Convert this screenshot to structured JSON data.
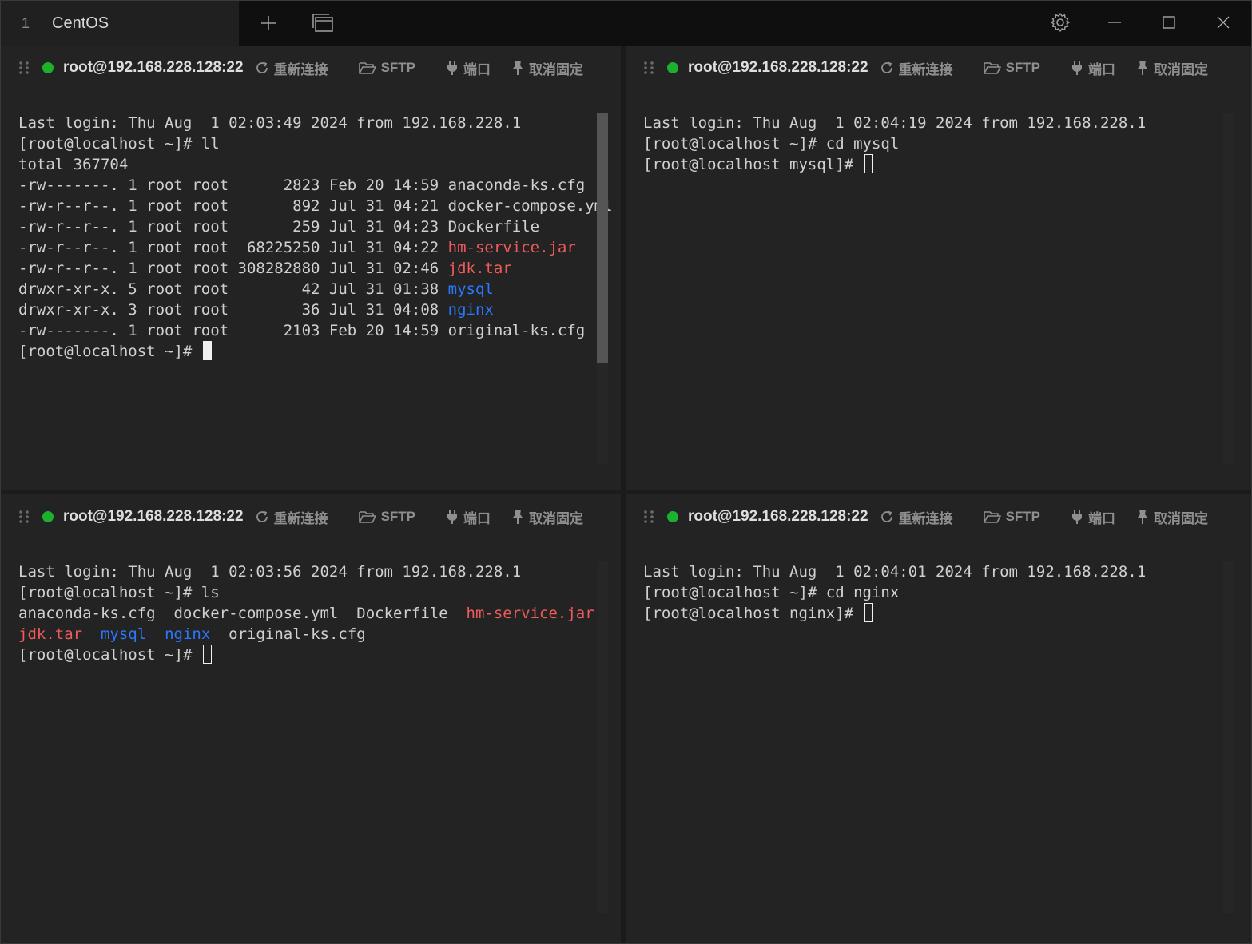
{
  "tabs": [
    {
      "number": "1",
      "label": "CentOS"
    }
  ],
  "icons": {
    "new_tab": "plus-icon",
    "window_list": "windows-icon",
    "settings": "gear-icon",
    "minimize": "minimize-icon",
    "maximize": "maximize-icon",
    "close": "close-icon"
  },
  "colors": {
    "status_connected": "#1db02e",
    "ls_archive": "#ef5a5a",
    "ls_directory": "#2a78ff"
  },
  "toolbar_labels": {
    "reconnect": "重新连接",
    "sftp": "SFTP",
    "port": "端口",
    "unpin": "取消固定"
  },
  "panes": [
    {
      "host": "root@192.168.228.128:22",
      "lines": [
        {
          "text": "Last login: Thu Aug  1 02:03:49 2024 from 192.168.228.1"
        },
        {
          "text": "[root@localhost ~]# ll"
        },
        {
          "text": "total 367704"
        },
        {
          "text": "-rw-------. 1 root root      2823 Feb 20 14:59 ",
          "name": "anaconda-ks.cfg",
          "color": ""
        },
        {
          "text": "-rw-r--r--. 1 root root       892 Jul 31 04:21 ",
          "name": "docker-compose.yml",
          "color": ""
        },
        {
          "text": "-rw-r--r--. 1 root root       259 Jul 31 04:23 ",
          "name": "Dockerfile",
          "color": ""
        },
        {
          "text": "-rw-r--r--. 1 root root  68225250 Jul 31 04:22 ",
          "name": "hm-service.jar",
          "color": "red"
        },
        {
          "text": "-rw-r--r--. 1 root root 308282880 Jul 31 02:46 ",
          "name": "jdk.tar",
          "color": "red"
        },
        {
          "text": "drwxr-xr-x. 5 root root        42 Jul 31 01:38 ",
          "name": "mysql",
          "color": "blue"
        },
        {
          "text": "drwxr-xr-x. 3 root root        36 Jul 31 04:08 ",
          "name": "nginx",
          "color": "blue"
        },
        {
          "text": "-rw-------. 1 root root      2103 Feb 20 14:59 ",
          "name": "original-ks.cfg",
          "color": ""
        }
      ],
      "prompt": "[root@localhost ~]# ",
      "cursor": "solid"
    },
    {
      "host": "root@192.168.228.128:22",
      "lines": [
        {
          "text": "Last login: Thu Aug  1 02:04:19 2024 from 192.168.228.1"
        },
        {
          "text": "[root@localhost ~]# cd mysql"
        }
      ],
      "prompt": "[root@localhost mysql]# ",
      "cursor": "hollow"
    },
    {
      "host": "root@192.168.228.128:22",
      "lines": [
        {
          "text": "Last login: Thu Aug  1 02:03:56 2024 from 192.168.228.1"
        },
        {
          "text": "[root@localhost ~]# ls"
        },
        {
          "segments": [
            {
              "text": "anaconda-ks.cfg  ",
              "color": ""
            },
            {
              "text": "docker-compose.yml  ",
              "color": ""
            },
            {
              "text": "Dockerfile  ",
              "color": ""
            },
            {
              "text": "hm-service.jar",
              "color": "red"
            }
          ]
        },
        {
          "segments": [
            {
              "text": "jdk.tar",
              "color": "red"
            },
            {
              "text": "  ",
              "color": ""
            },
            {
              "text": "mysql",
              "color": "blue"
            },
            {
              "text": "  ",
              "color": ""
            },
            {
              "text": "nginx",
              "color": "blue"
            },
            {
              "text": "  original-ks.cfg",
              "color": ""
            }
          ]
        }
      ],
      "prompt": "[root@localhost ~]# ",
      "cursor": "hollow"
    },
    {
      "host": "root@192.168.228.128:22",
      "lines": [
        {
          "text": "Last login: Thu Aug  1 02:04:01 2024 from 192.168.228.1"
        },
        {
          "text": "[root@localhost ~]# cd nginx"
        }
      ],
      "prompt": "[root@localhost nginx]# ",
      "cursor": "hollow"
    }
  ]
}
